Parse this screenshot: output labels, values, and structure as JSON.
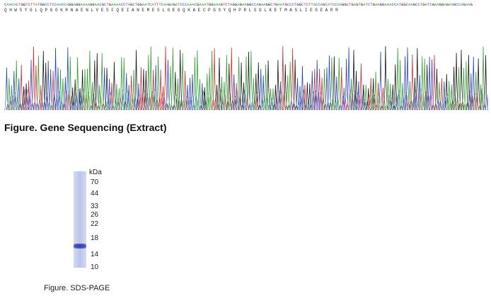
{
  "sequencing": {
    "nucleotides": "CAACACTGGTCTTATGGCCTCCAACCAGGAGGAAAAGGAACGCTGAAAACCTAGCTGGAATCATTTCAAGAGATCCCAAACGAAATGGAAAGTCTAGGAGAAGGCCAGAAGGCTGAATGCCCTGGCTCTTACCAGCATCCCAGGCTGAGTGATCTGAAGGAAACCATGGCAAGCCTGATCGAAGGAGAAGCCAGAAG",
    "amino_acids": "Q  H  W  S  Y  G  L  Q  P  G  G  K  R  N  A  E  N  L  V  E  S  F  Q  E  I  A  N  E  M  E  S  L  G  E  G  Q  K  A  E  C  P  G  S  Y  Q  H  P  R  L  S  D  L  K  E  T  M  A  S  L  I  E  G  E  A  R  R",
    "caption": "Figure. Gene Sequencing (Extract)"
  },
  "gel": {
    "unit_label": "kDa",
    "markers": [
      "70",
      "44",
      "33",
      "26",
      "22",
      "18",
      "14",
      "10"
    ],
    "caption": "Figure. SDS-PAGE"
  },
  "colors": {
    "A": "#2ca02c",
    "C": "#1f3fd6",
    "G": "#111111",
    "T": "#d62728"
  }
}
